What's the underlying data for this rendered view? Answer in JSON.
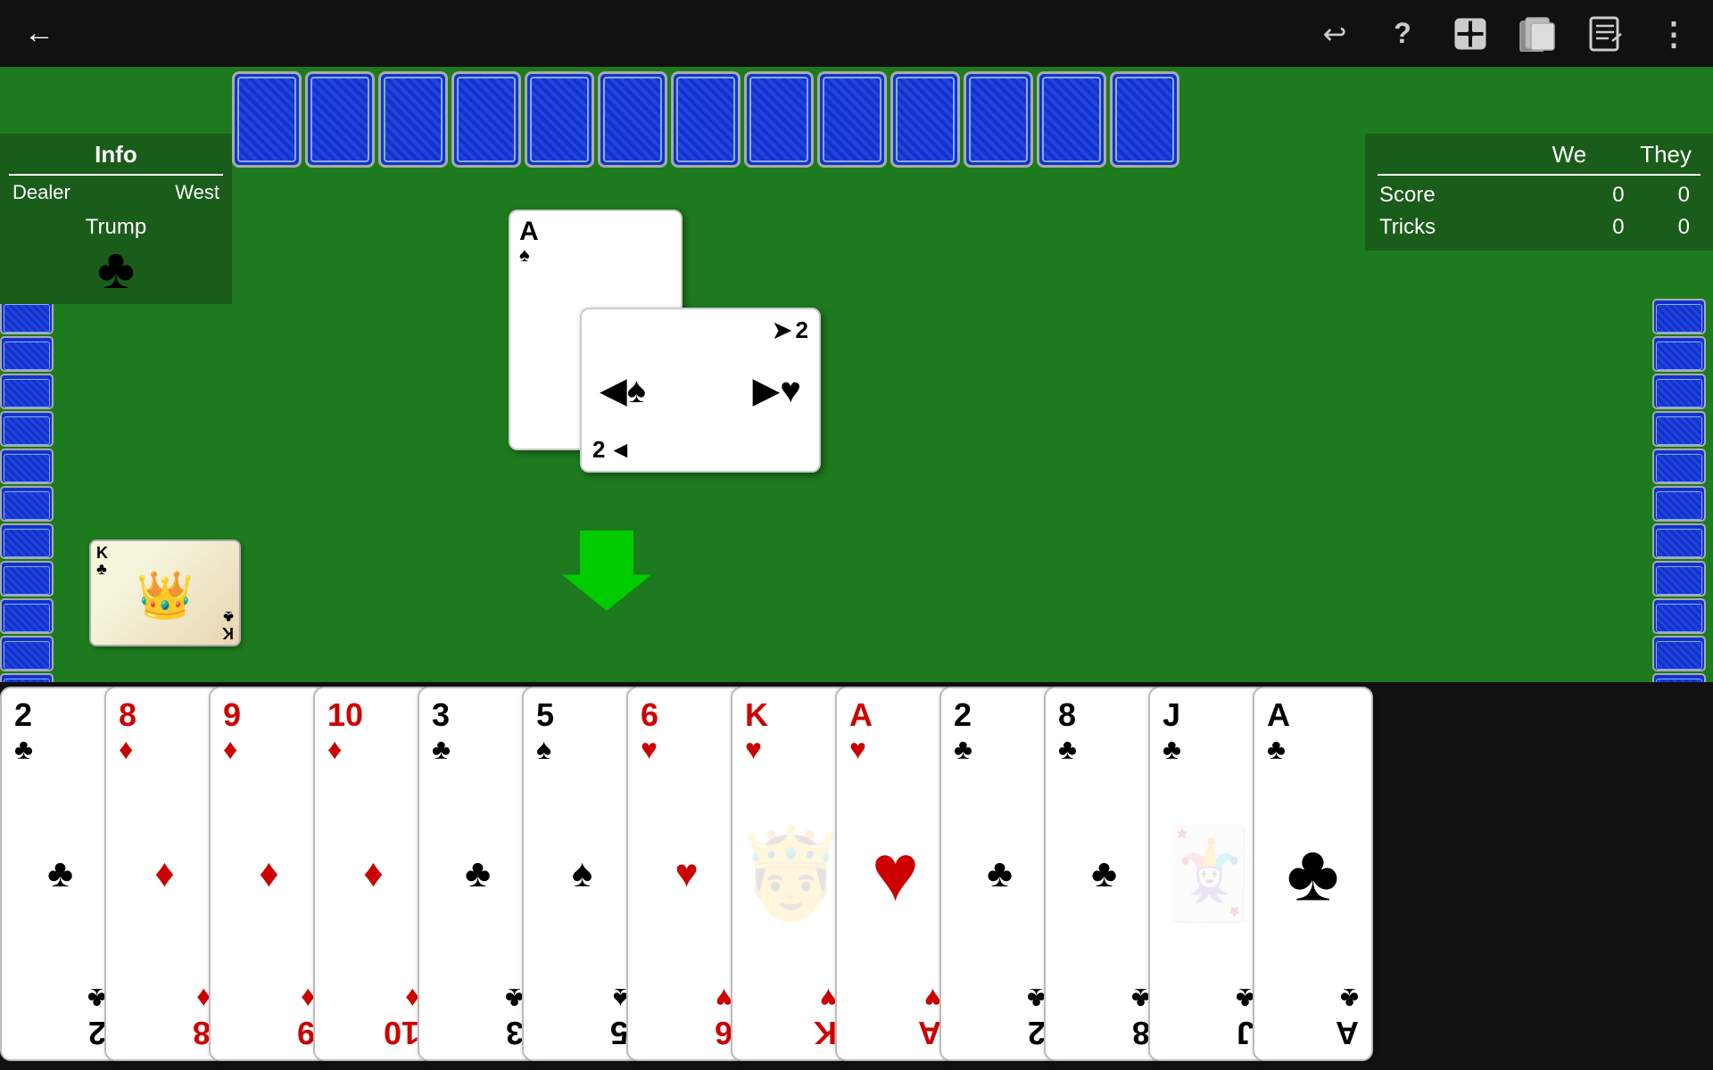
{
  "topbar": {
    "back_label": "←",
    "icons": [
      {
        "name": "undo-icon",
        "symbol": "↩",
        "label": "Undo"
      },
      {
        "name": "help-icon",
        "symbol": "?",
        "label": "Help"
      },
      {
        "name": "add-icon",
        "symbol": "⊞",
        "label": "Add"
      },
      {
        "name": "cards-icon",
        "symbol": "🂠",
        "label": "Cards"
      },
      {
        "name": "notes-icon",
        "symbol": "📝",
        "label": "Notes"
      },
      {
        "name": "more-icon",
        "symbol": "⋮",
        "label": "More"
      }
    ]
  },
  "info_panel": {
    "header": "Info",
    "dealer_label": "Dealer",
    "dealer_value": "West",
    "trump_label": "Trump",
    "trump_suit": "♣"
  },
  "score_panel": {
    "we_label": "We",
    "they_label": "They",
    "score_label": "Score",
    "tricks_label": "Tricks",
    "we_score": "0",
    "they_score": "0",
    "we_tricks": "0",
    "they_tricks": "0"
  },
  "top_cards_count": 13,
  "left_cards_count": 13,
  "right_cards_count": 13,
  "center_cards": {
    "card1": {
      "rank": "A",
      "suit": "♠",
      "color": "black"
    },
    "card2": {
      "rank": "2",
      "suit": "♠",
      "color": "black"
    }
  },
  "king_card": {
    "rank": "K",
    "suit": "♣",
    "color": "black"
  },
  "hand_cards": [
    {
      "rank": "2",
      "suit": "♣",
      "color": "black"
    },
    {
      "rank": "8",
      "suit": "♦",
      "color": "red"
    },
    {
      "rank": "9",
      "suit": "♦",
      "color": "red"
    },
    {
      "rank": "10",
      "suit": "♦",
      "color": "red"
    },
    {
      "rank": "3",
      "suit": "♣",
      "color": "black"
    },
    {
      "rank": "5",
      "suit": "♠",
      "color": "black"
    },
    {
      "rank": "6",
      "suit": "♥",
      "color": "red"
    },
    {
      "rank": "K",
      "suit": "♥",
      "color": "red"
    },
    {
      "rank": "A",
      "suit": "♥",
      "color": "red"
    },
    {
      "rank": "2",
      "suit": "♣",
      "color": "black"
    },
    {
      "rank": "8",
      "suit": "♣",
      "color": "black"
    },
    {
      "rank": "J",
      "suit": "♣",
      "color": "black"
    },
    {
      "rank": "A",
      "suit": "♣",
      "color": "black"
    }
  ]
}
